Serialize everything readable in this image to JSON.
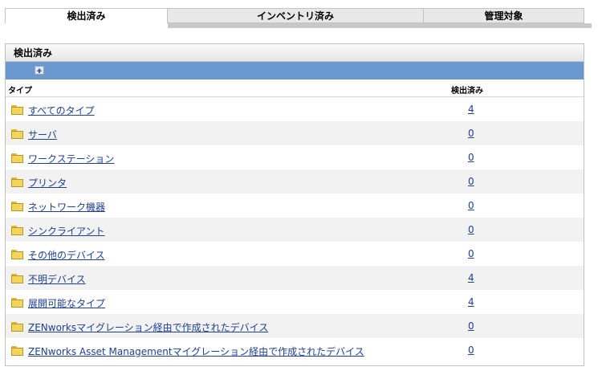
{
  "tabs": [
    {
      "label": "検出済み",
      "active": true
    },
    {
      "label": "インベントリ済み",
      "active": false
    },
    {
      "label": "管理対象",
      "active": false
    }
  ],
  "panel": {
    "title": "検出済み",
    "toolbar_icon": "up-folder-icon",
    "columns": {
      "type": "タイプ",
      "count": "検出済み"
    },
    "rows": [
      {
        "name": "すべてのタイプ",
        "count": "4"
      },
      {
        "name": "サーバ",
        "count": "0"
      },
      {
        "name": "ワークステーション",
        "count": "0"
      },
      {
        "name": "プリンタ",
        "count": "0"
      },
      {
        "name": "ネットワーク機器",
        "count": "0"
      },
      {
        "name": "シンクライアント",
        "count": "0"
      },
      {
        "name": "その他のデバイス",
        "count": "0"
      },
      {
        "name": "不明デバイス",
        "count": "4"
      },
      {
        "name": "展開可能なタイプ",
        "count": "4"
      },
      {
        "name": "ZENworksマイグレーション経由で作成されたデバイス",
        "count": "0"
      },
      {
        "name": "ZENworks Asset Managementマイグレーション経由で作成されたデバイス",
        "count": "0"
      }
    ]
  },
  "colors": {
    "toolbar": "#6b98cf",
    "link": "#1f3f8f",
    "folder": "#f2d55a"
  }
}
